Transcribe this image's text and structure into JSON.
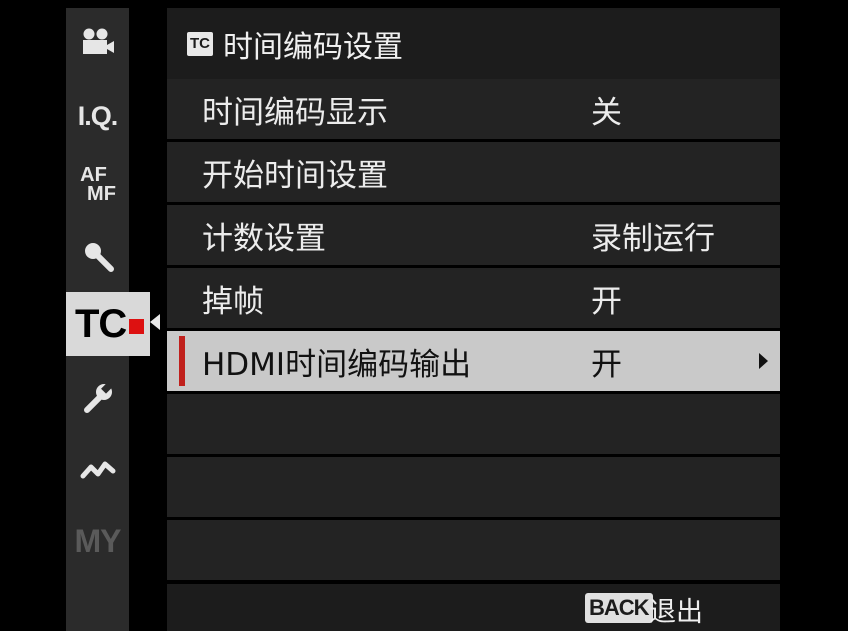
{
  "sidebar": {
    "items": [
      {
        "id": "movie",
        "icon": "movie-camera-icon",
        "label": ""
      },
      {
        "id": "iq",
        "icon": "image-quality-icon",
        "label": "I.Q."
      },
      {
        "id": "af",
        "icon": "af-mf-icon",
        "label_top": "AF",
        "label_bottom": "MF"
      },
      {
        "id": "audio",
        "icon": "microphone-icon",
        "label": ""
      },
      {
        "id": "tc",
        "icon": "timecode-icon",
        "label": "TC"
      },
      {
        "id": "setup",
        "icon": "wrench-icon",
        "label": ""
      },
      {
        "id": "connection",
        "icon": "connection-icon",
        "label": ""
      },
      {
        "id": "my",
        "icon": "my-menu-icon",
        "label": "MY"
      }
    ]
  },
  "header": {
    "badge": "TC",
    "title": "时间编码设置"
  },
  "rows": [
    {
      "label": "时间编码显示",
      "value": "关"
    },
    {
      "label": "开始时间设置",
      "value": ""
    },
    {
      "label": "计数设置",
      "value": "录制运行"
    },
    {
      "label": "掉帧",
      "value": "开"
    },
    {
      "label": "HDMI时间编码输出",
      "value": "开",
      "selected": true
    },
    {
      "label": "",
      "value": ""
    },
    {
      "label": "",
      "value": ""
    },
    {
      "label": "",
      "value": ""
    }
  ],
  "footer": {
    "back_label": "BACK",
    "exit_label": "退出"
  },
  "colors": {
    "accent": "#c0201c",
    "selected_bg": "#c9c9c9",
    "row_bg": "#232323",
    "header_bg": "#1c1c1c"
  }
}
